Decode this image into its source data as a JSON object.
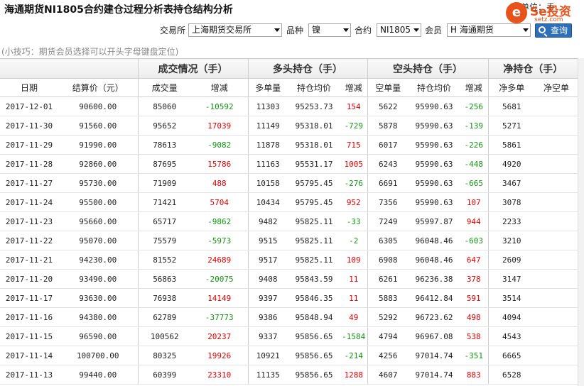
{
  "page": {
    "title": "海通期货NI1805合约建仓过程分析表持仓结构分析",
    "unit_label": "单位：手",
    "tip": "(小技巧：期货会员选择可以开头字母键盘定位)"
  },
  "logo": {
    "icon": "e",
    "text": "Se投资",
    "sub": "setz.com"
  },
  "filters": {
    "exchange_label": "交易所",
    "exchange_value": "上海期货交易所",
    "variety_label": "品种",
    "variety_value": "镍",
    "contract_label": "合约",
    "contract_value": "NI1805",
    "member_label": "会员",
    "member_value": "H 海通期货",
    "query_label": "查询"
  },
  "table": {
    "groups": [
      "成交情况（手）",
      "多头持仓（手）",
      "空头持仓（手）",
      "净持仓（手）"
    ],
    "columns": [
      "日期",
      "结算价（元）",
      "成交量",
      "增减",
      "多单量",
      "持仓均价",
      "增减",
      "空单量",
      "持仓均价",
      "增减",
      "净多单",
      "净空单"
    ],
    "rows": [
      [
        "2017-12-01",
        "90600.00",
        "85060",
        "-10592",
        "11303",
        "95253.73",
        "154",
        "5622",
        "95990.63",
        "-256",
        "5681",
        ""
      ],
      [
        "2017-11-30",
        "91560.00",
        "95652",
        "17039",
        "11149",
        "95318.01",
        "-729",
        "5878",
        "95990.63",
        "-139",
        "5271",
        ""
      ],
      [
        "2017-11-29",
        "91990.00",
        "78613",
        "-9082",
        "11878",
        "95318.01",
        "715",
        "6017",
        "95990.63",
        "-226",
        "5861",
        ""
      ],
      [
        "2017-11-28",
        "92860.00",
        "87695",
        "15786",
        "11163",
        "95531.17",
        "1005",
        "6243",
        "95990.63",
        "-448",
        "4920",
        ""
      ],
      [
        "2017-11-27",
        "95730.00",
        "71909",
        "488",
        "10158",
        "95795.45",
        "-276",
        "6691",
        "95990.63",
        "-665",
        "3467",
        ""
      ],
      [
        "2017-11-24",
        "95500.00",
        "71421",
        "5704",
        "10434",
        "95795.45",
        "952",
        "7356",
        "95990.63",
        "107",
        "3078",
        ""
      ],
      [
        "2017-11-23",
        "95660.00",
        "65717",
        "-9862",
        "9482",
        "95825.11",
        "-33",
        "7249",
        "95997.87",
        "944",
        "2233",
        ""
      ],
      [
        "2017-11-22",
        "95070.00",
        "75579",
        "-5973",
        "9515",
        "95825.11",
        "-2",
        "6305",
        "96048.46",
        "-603",
        "3210",
        ""
      ],
      [
        "2017-11-21",
        "94230.00",
        "81552",
        "24689",
        "9517",
        "95825.11",
        "109",
        "6908",
        "96048.46",
        "647",
        "2609",
        ""
      ],
      [
        "2017-11-20",
        "93490.00",
        "56863",
        "-20075",
        "9408",
        "95843.59",
        "11",
        "6261",
        "96236.38",
        "378",
        "3147",
        ""
      ],
      [
        "2017-11-17",
        "93630.00",
        "76938",
        "14149",
        "9397",
        "95846.35",
        "11",
        "5883",
        "96412.84",
        "591",
        "3514",
        ""
      ],
      [
        "2017-11-16",
        "94380.00",
        "62789",
        "-37773",
        "9386",
        "95848.94",
        "49",
        "5292",
        "96723.62",
        "498",
        "4094",
        ""
      ],
      [
        "2017-11-15",
        "96590.00",
        "100562",
        "20237",
        "9337",
        "95856.65",
        "-1584",
        "4794",
        "96967.08",
        "538",
        "4543",
        ""
      ],
      [
        "2017-11-14",
        "100700.00",
        "80325",
        "19926",
        "10921",
        "95856.65",
        "-214",
        "4256",
        "97014.74",
        "-351",
        "6665",
        ""
      ],
      [
        "2017-11-13",
        "99440.00",
        "60399",
        "23310",
        "11135",
        "95856.65",
        "1288",
        "4607",
        "97014.74",
        "883",
        "6528",
        ""
      ]
    ]
  },
  "colors": {
    "increase": "#e60000",
    "decrease": "#119611",
    "brand": "#e8531b",
    "button": "#2f6fb8"
  }
}
